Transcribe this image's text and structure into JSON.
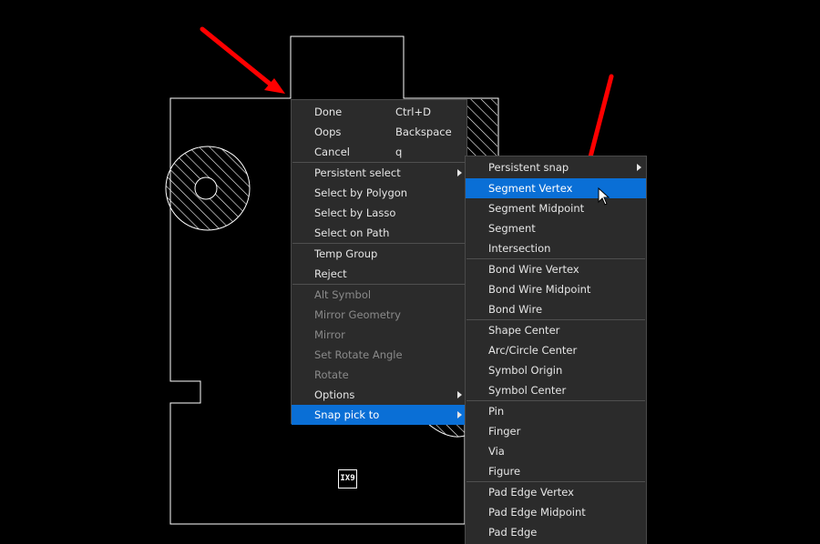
{
  "main_menu": {
    "items": [
      {
        "label": "Done",
        "shortcut": "Ctrl+D"
      },
      {
        "label": "Oops",
        "shortcut": "Backspace"
      },
      {
        "label": "Cancel",
        "shortcut": "q"
      },
      {
        "label": "Persistent select"
      },
      {
        "label": "Select by Polygon"
      },
      {
        "label": "Select by Lasso"
      },
      {
        "label": "Select on Path"
      },
      {
        "label": "Temp Group"
      },
      {
        "label": "Reject"
      },
      {
        "label": "Alt Symbol"
      },
      {
        "label": "Mirror Geometry"
      },
      {
        "label": "Mirror"
      },
      {
        "label": "Set Rotate Angle"
      },
      {
        "label": "Rotate"
      },
      {
        "label": "Options"
      },
      {
        "label": "Snap pick to"
      }
    ]
  },
  "sub_menu": {
    "items": [
      {
        "label": "Persistent snap"
      },
      {
        "label": "Segment Vertex"
      },
      {
        "label": "Segment Midpoint"
      },
      {
        "label": "Segment"
      },
      {
        "label": "Intersection"
      },
      {
        "label": "Bond Wire Vertex"
      },
      {
        "label": "Bond Wire Midpoint"
      },
      {
        "label": "Bond Wire"
      },
      {
        "label": "Shape Center"
      },
      {
        "label": "Arc/Circle Center"
      },
      {
        "label": "Symbol Origin"
      },
      {
        "label": "Symbol Center"
      },
      {
        "label": "Pin"
      },
      {
        "label": "Finger"
      },
      {
        "label": "Via"
      },
      {
        "label": "Figure"
      },
      {
        "label": "Pad Edge Vertex"
      },
      {
        "label": "Pad Edge Midpoint"
      },
      {
        "label": "Pad Edge"
      }
    ]
  },
  "canvas": {
    "pin_label": "IX9"
  },
  "colors": {
    "background": "#000000",
    "menu_bg": "#2b2b2b",
    "highlight": "#0a6fd6",
    "annotation_arrow": "#ff0000"
  }
}
